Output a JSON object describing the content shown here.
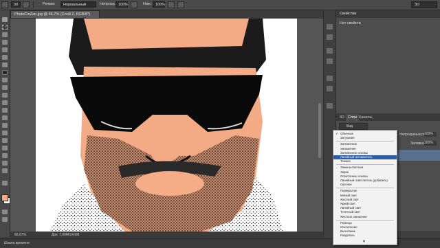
{
  "options_bar": {
    "mode_label": "Режим:",
    "mode_value": "Нормальный",
    "opacity_label": "Непрозр.:",
    "opacity_value": "100%",
    "flow_label": "Наж.:",
    "flow_value": "100%",
    "brush_size": "30",
    "workspace": "3D"
  },
  "document": {
    "tab_title": "PhotoCinZan.jpg @ 66,7% (Слой 2, RGB/8*)",
    "zoom": "66,67%",
    "doc_size": "Док: 7,00M/14,6M",
    "timeline_label": "Шкала времени"
  },
  "properties_panel": {
    "title": "Свойства",
    "empty_text": "Нет свойств"
  },
  "layers_panel": {
    "tabs": [
      "3D",
      "Слои",
      "Каналы"
    ],
    "filter_label": "Вид",
    "opacity_label": "Непрозрачность:",
    "opacity_value": "100%",
    "fill_label": "Заливка:",
    "fill_value": "100%"
  },
  "blend_menu": {
    "items": [
      {
        "label": "Обычные",
        "checked": true
      },
      {
        "label": "Затухание"
      },
      {
        "sep": true
      },
      {
        "label": "Затемнение"
      },
      {
        "label": "Умножение"
      },
      {
        "label": "Затемнение основы"
      },
      {
        "label": "Линейный затемнитель",
        "selected": true
      },
      {
        "label": "Темнее"
      },
      {
        "sep": true
      },
      {
        "label": "Замена светлым"
      },
      {
        "label": "Экран"
      },
      {
        "label": "Осветление основы"
      },
      {
        "label": "Линейный осветлитель (добавить)"
      },
      {
        "label": "Светлее"
      },
      {
        "sep": true
      },
      {
        "label": "Перекрытие"
      },
      {
        "label": "Мягкий свет"
      },
      {
        "label": "Жесткий свет"
      },
      {
        "label": "Яркий свет"
      },
      {
        "label": "Линейный свет"
      },
      {
        "label": "Точечный свет"
      },
      {
        "label": "Жесткое смешение"
      },
      {
        "sep": true
      },
      {
        "label": "Разница"
      },
      {
        "label": "Исключение"
      },
      {
        "label": "Вычитание"
      },
      {
        "label": "Разделить"
      }
    ]
  },
  "colors": {
    "foreground": "#f4ad86",
    "background": "#ffffff",
    "menu_highlight": "#2d5fa8",
    "skin": "#f2ab85"
  }
}
